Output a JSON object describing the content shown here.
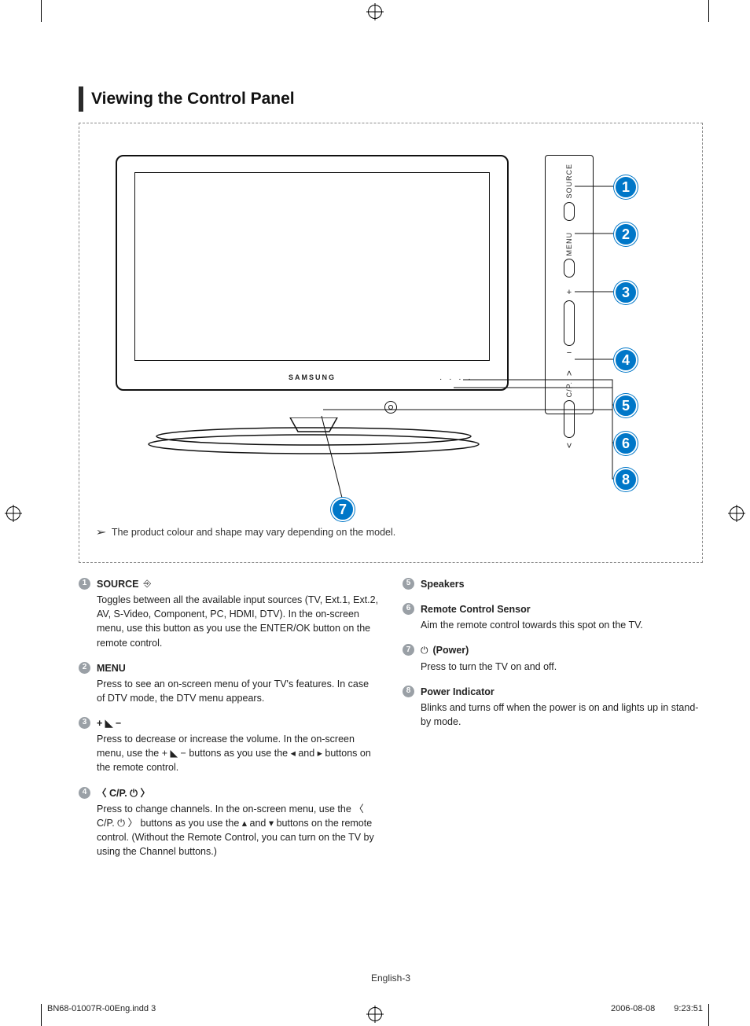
{
  "section_title": "Viewing the Control Panel",
  "brand": "SAMSUNG",
  "figure_note_icon": "➢",
  "figure_note": "The product colour and shape may vary depending on the model.",
  "side_panel": {
    "source_label": "SOURCE",
    "menu_label": "MENU",
    "vol_plus": "+",
    "vol_minus": "−",
    "ch_label": "C/P.",
    "ch_up": "˄",
    "ch_down": "˅"
  },
  "callouts": [
    "1",
    "2",
    "3",
    "4",
    "5",
    "6",
    "7",
    "8"
  ],
  "left_items": [
    {
      "num": "1",
      "title": "SOURCE",
      "title_glyph": "⎆",
      "desc": "Toggles between all the available input sources (TV, Ext.1, Ext.2, AV, S-Video, Component, PC, HDMI, DTV). In the on-screen menu, use this button as you use the ENTER/OK button on the remote control."
    },
    {
      "num": "2",
      "title": "MENU",
      "desc": "Press to see an on-screen menu of your TV's features. In case of DTV mode, the DTV menu appears."
    },
    {
      "num": "3",
      "title_sym": "+  ◣  −",
      "desc": "Press to decrease or increase the volume. In the on-screen menu, use the + ◣ − buttons as you use the ◂ and ▸ buttons on the remote control."
    },
    {
      "num": "4",
      "title_sym": "〈  C/P. ⏻  〉",
      "desc": "Press to change channels. In the on-screen menu, use the 〈 C/P. ⏻ 〉 buttons as you use the ▴ and ▾ buttons on the remote control. (Without the Remote Control, you can turn on the TV by using the Channel buttons.)"
    }
  ],
  "right_items": [
    {
      "num": "5",
      "title": "Speakers",
      "desc": ""
    },
    {
      "num": "6",
      "title": "Remote Control Sensor",
      "desc": "Aim the remote control towards this spot on the TV."
    },
    {
      "num": "7",
      "title_glyph": "⏻",
      "title": "(Power)",
      "desc": "Press to turn the TV on and off."
    },
    {
      "num": "8",
      "title": "Power Indicator",
      "desc": "Blinks and turns off when the power is on and lights up in stand-by mode."
    }
  ],
  "page_number": "English-3",
  "footer": {
    "file": "BN68-01007R-00Eng.indd   3",
    "date": "2006-08-08",
    "time": "9:23:51"
  }
}
